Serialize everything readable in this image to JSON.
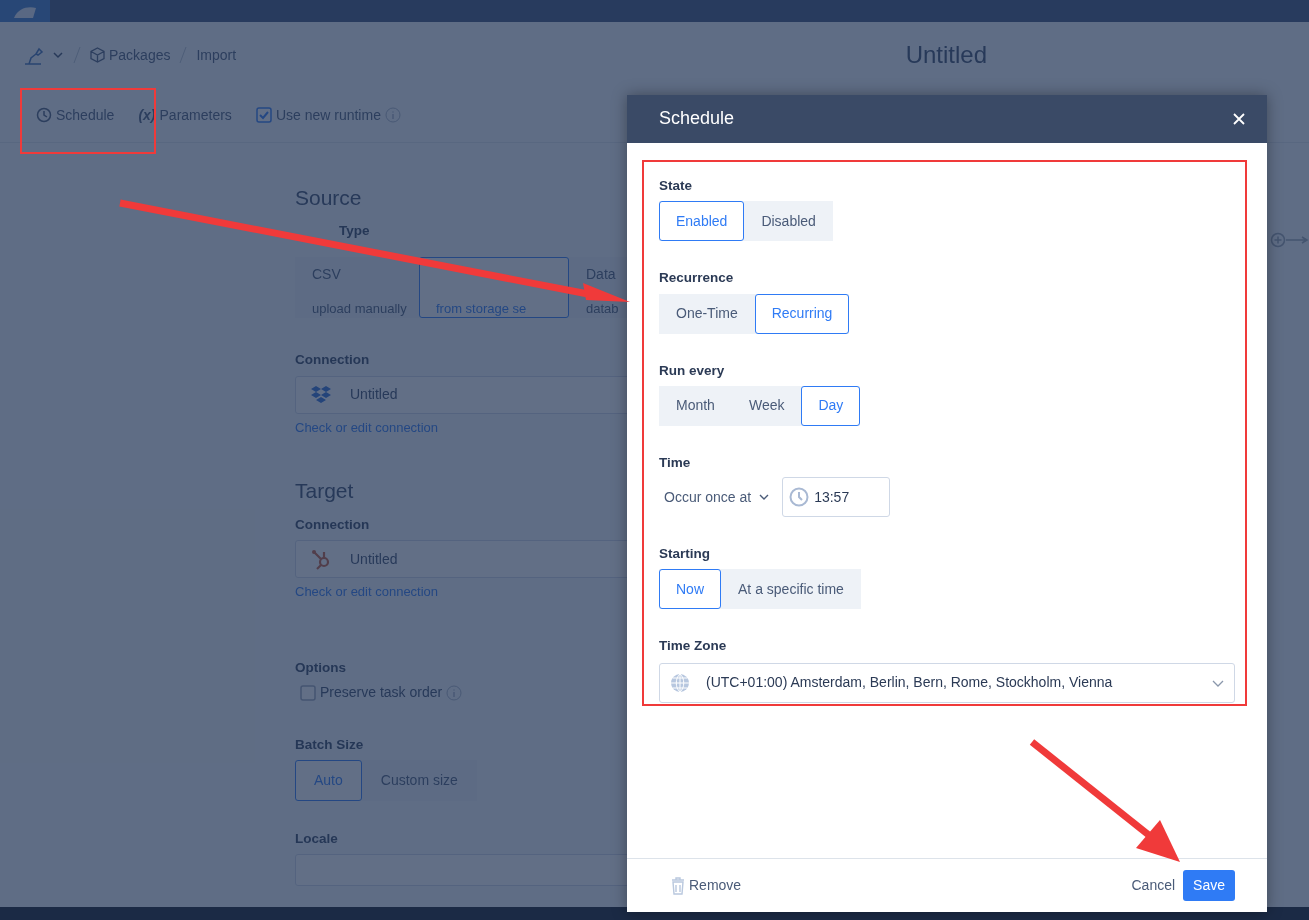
{
  "breadcrumb": [
    {
      "label": "Packages"
    },
    {
      "label": "Import"
    }
  ],
  "page_title": "Untitled",
  "toolbar": [
    {
      "kind": "clock",
      "label": "Schedule"
    },
    {
      "kind": "variable",
      "glyph": "(x)",
      "label": "Parameters"
    },
    {
      "kind": "checkbox",
      "label": "Use new runtime",
      "checked": true
    }
  ],
  "form": {
    "source_heading": "Source",
    "source_type_label": "Type",
    "source_types": [
      {
        "title": "CSV",
        "subtitle": "upload manually",
        "selected": false
      },
      {
        "subtitle": "from storage se",
        "selected": true
      },
      {
        "title": "Data",
        "subtitle": "datab",
        "selected": false
      }
    ],
    "source_connection": {
      "label": "Connection",
      "value": "Untitled",
      "link": "Check or edit connection"
    },
    "target_heading": "Target",
    "target_connection": {
      "label": "Connection",
      "value": "Untitled",
      "link": "Check or edit connection"
    },
    "options_label": "Options",
    "options": [
      {
        "label": "Preserve task order",
        "checked": false
      }
    ],
    "batch_size": {
      "label": "Batch Size",
      "choices": [
        {
          "label": "Auto",
          "selected": true
        },
        {
          "label": "Custom size",
          "selected": false
        }
      ]
    },
    "locale": {
      "label": "Locale"
    }
  },
  "modal": {
    "title": "Schedule",
    "sections": [
      {
        "kind": "segmented",
        "label": "State",
        "choices": [
          {
            "label": "Enabled",
            "selected": true
          },
          {
            "label": "Disabled",
            "selected": false
          }
        ]
      },
      {
        "kind": "segmented",
        "label": "Recurrence",
        "choices": [
          {
            "label": "One-Time",
            "selected": false
          },
          {
            "label": "Recurring",
            "selected": true
          }
        ]
      },
      {
        "kind": "segmented",
        "label": "Run every",
        "choices": [
          {
            "label": "Month",
            "selected": false
          },
          {
            "label": "Week",
            "selected": false
          },
          {
            "label": "Day",
            "selected": true
          }
        ]
      },
      {
        "kind": "time",
        "label": "Time",
        "mode": "Occur once at",
        "value": "13:57"
      },
      {
        "kind": "segmented",
        "label": "Starting",
        "choices": [
          {
            "label": "Now",
            "selected": true
          },
          {
            "label": "At a specific time",
            "selected": false
          }
        ]
      },
      {
        "kind": "select",
        "label": "Time Zone",
        "value": "(UTC+01:00) Amsterdam, Berlin, Bern, Rome, Stockholm, Vienna"
      }
    ],
    "remove": "Remove",
    "cancel": "Cancel",
    "save": "Save"
  }
}
